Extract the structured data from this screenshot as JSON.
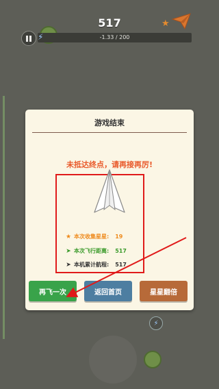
{
  "hud": {
    "score": "517",
    "progress_text": "-1.33 / 200",
    "progress_fraction": 0.0
  },
  "dialog": {
    "title": "游戏结束",
    "warning": "未抵达终点，请再接再厉!",
    "stats": [
      {
        "label": "本次收集星星:",
        "value": "19",
        "icon": "star-icon"
      },
      {
        "label": "本次飞行距离:",
        "value": "517",
        "icon": "plane-icon"
      },
      {
        "label": "本机累计航程:",
        "value": "517",
        "icon": "plane-icon"
      }
    ],
    "buttons": {
      "retry": "再飞一次",
      "home": "返回首页",
      "double": "星星翻倍"
    }
  },
  "colors": {
    "retry": "#39a34a",
    "home": "#4d7ea1",
    "double": "#b76a39",
    "warning": "#e9592a",
    "highlight": "#e01a1a"
  }
}
